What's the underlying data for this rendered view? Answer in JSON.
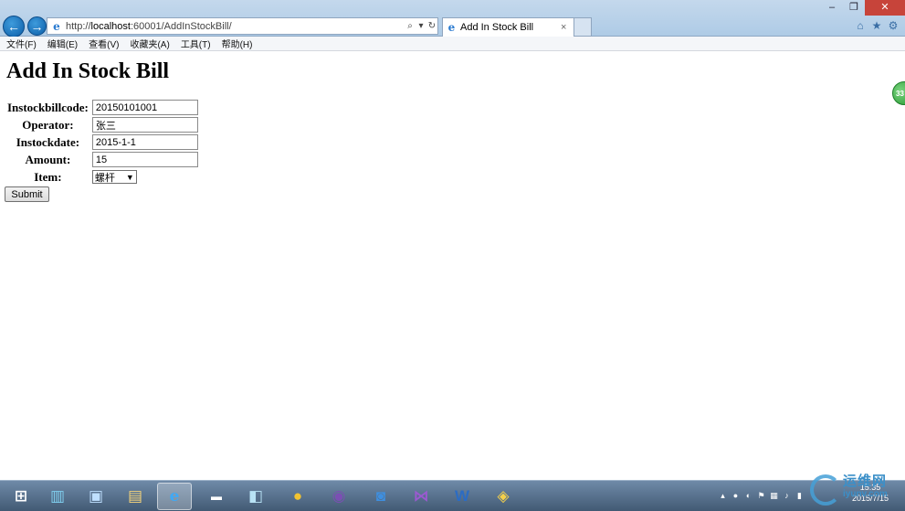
{
  "browser": {
    "address": {
      "prefix": "http://",
      "host": "localhost",
      "rest": ":60001/AddInStockBill/"
    },
    "tab_title": "Add In Stock Bill",
    "tab_close": "×",
    "window_buttons": {
      "minimize": "–",
      "restore": "❐",
      "close": "✕"
    },
    "address_tools": {
      "search": "⌕",
      "dropdown": "▾",
      "refresh": "↻"
    },
    "tool_icons": {
      "home": "⌂",
      "favorites": "★",
      "settings": "⚙"
    }
  },
  "menu": [
    "文件(F)",
    "编辑(E)",
    "查看(V)",
    "收藏夹(A)",
    "工具(T)",
    "帮助(H)"
  ],
  "page": {
    "heading": "Add In Stock Bill",
    "fields": [
      {
        "label": "Instockbillcode:",
        "value": "20150101001"
      },
      {
        "label": "Operator:",
        "value": "张三"
      },
      {
        "label": "Instockdate:",
        "value": "2015-1-1"
      },
      {
        "label": "Amount:",
        "value": "15"
      }
    ],
    "item": {
      "label": "Item:",
      "selected": "螺杆"
    },
    "submit_label": "Submit"
  },
  "floating_badge": "33",
  "taskbar": {
    "apps": [
      "windows-start",
      "server-manager",
      "remote-desktop",
      "file-explorer",
      "internet-explorer",
      "command-prompt",
      "notepad",
      "yellow-app",
      "eclipse",
      "sogou",
      "visual-studio",
      "word",
      "python"
    ],
    "active_app": "internet-explorer"
  },
  "clock": {
    "time": "15:35",
    "date": "2015/7/15"
  },
  "watermark": {
    "brand": "运维网",
    "url": "iyunv.com"
  },
  "colors": {
    "accent": "#0c5ea8",
    "taskbar": "#425a74",
    "close": "#c7443a"
  }
}
